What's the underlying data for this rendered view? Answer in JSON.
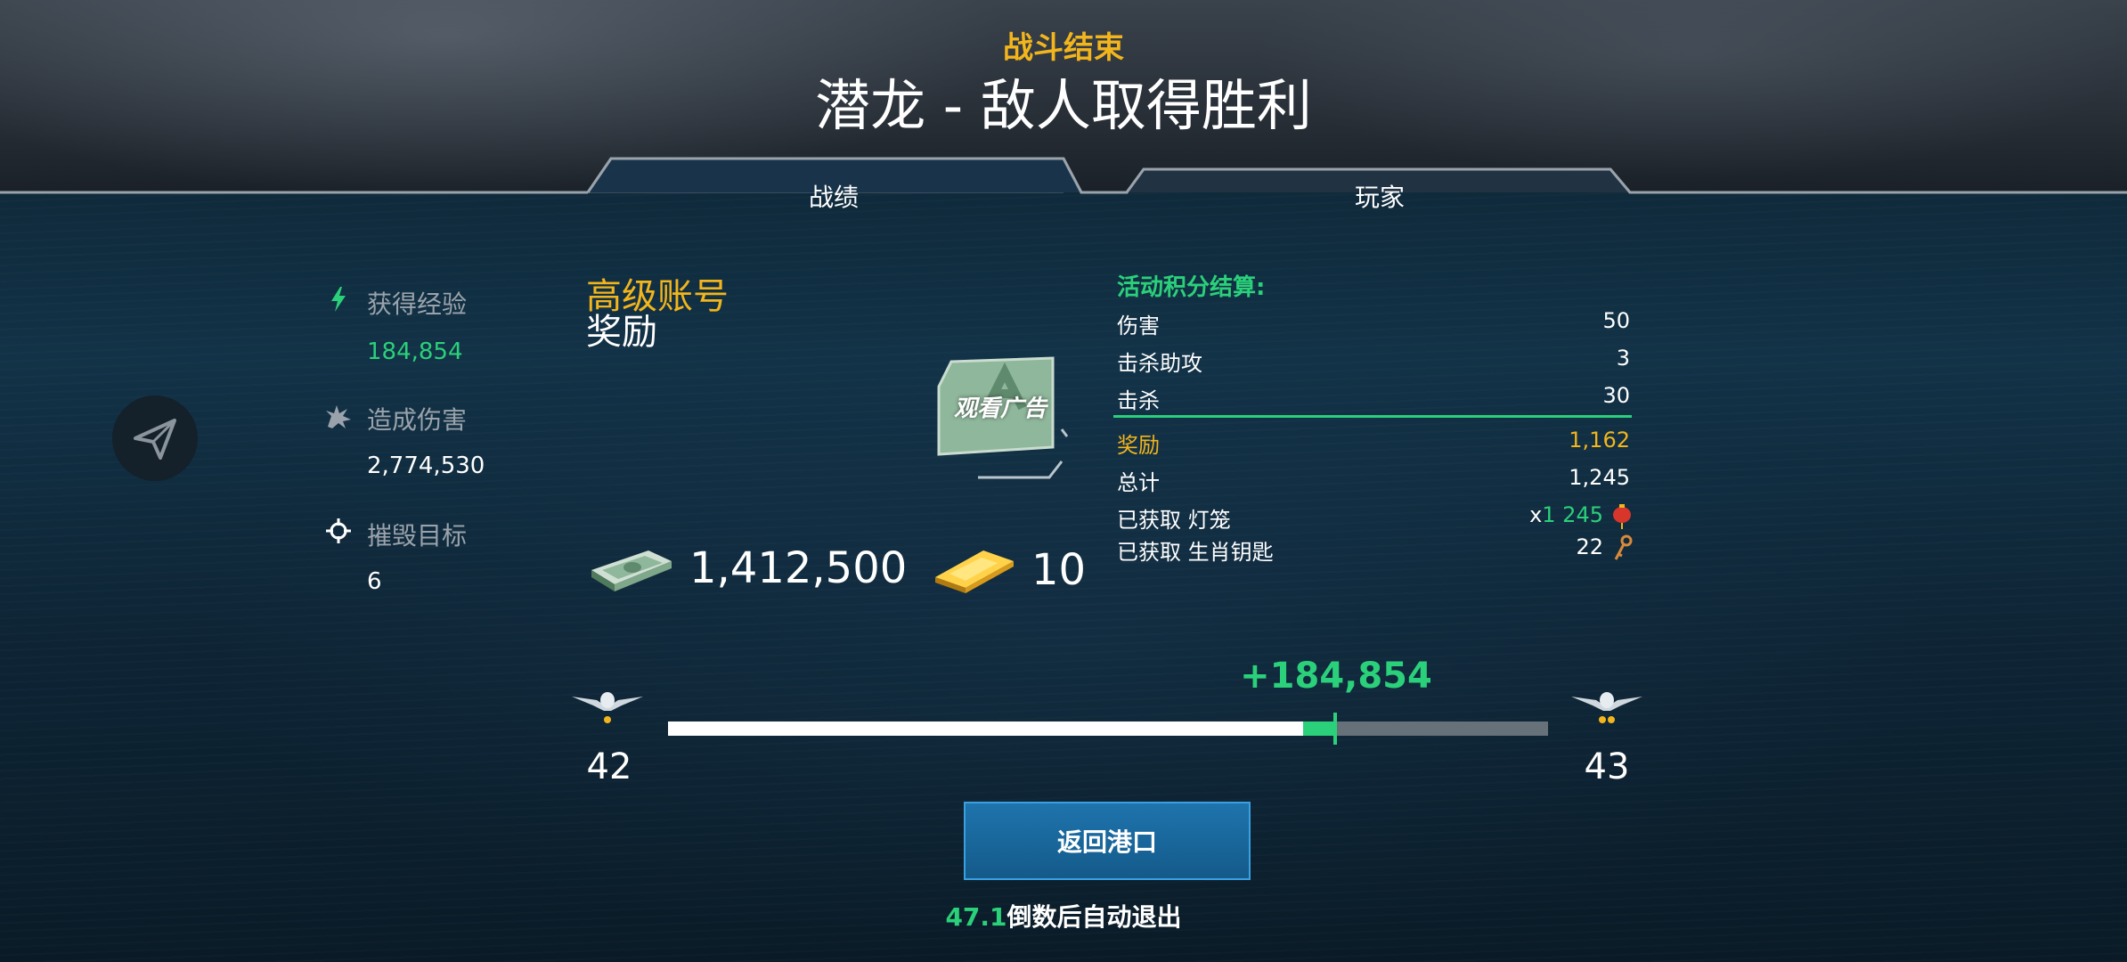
{
  "header": {
    "subtitle": "战斗结束",
    "title": "潜龙 - 敌人取得胜利"
  },
  "tabs": [
    {
      "label": "战绩",
      "active": true
    },
    {
      "label": "玩家",
      "active": false
    }
  ],
  "stats": [
    {
      "icon": "lightning-icon",
      "label": "获得经验",
      "value": "184,854",
      "value_color": "#2bd07a"
    },
    {
      "icon": "explosion-icon",
      "label": "造成伤害",
      "value": "2,774,530"
    },
    {
      "icon": "crosshair-icon",
      "label": "摧毁目标",
      "value": "6"
    }
  ],
  "premium": {
    "title": "高级账号",
    "subtitle": "奖励",
    "watch_ad_label": "观看广告",
    "money_value": "1,412,500",
    "gold_value": "10"
  },
  "event": {
    "title": "活动积分结算:",
    "rows": [
      {
        "label": "伤害",
        "value": "50"
      },
      {
        "label": "击杀助攻",
        "value": "3"
      },
      {
        "label": "击杀",
        "value": "30"
      },
      {
        "label": "奖励",
        "value": "1,162"
      },
      {
        "label": "总计",
        "value": "1,245"
      }
    ],
    "lantern": {
      "label": "已获取 灯笼",
      "prefix": "x",
      "value": "1 245",
      "icon": "lantern-icon"
    },
    "zodiac_key": {
      "label": "已获取 生肖钥匙",
      "value": "22",
      "icon": "key-icon"
    }
  },
  "progress": {
    "current_rank": "42",
    "next_rank": "43",
    "gain_label": "+184,854",
    "base_fraction": 0.722,
    "gain_fraction": 0.034
  },
  "footer": {
    "return_label": "返回港口",
    "countdown_value": "47.1",
    "countdown_text": "倒数后自动退出"
  },
  "colors": {
    "gold": "#f2b51c",
    "green": "#2bd07a",
    "button": "#1e74ad"
  }
}
